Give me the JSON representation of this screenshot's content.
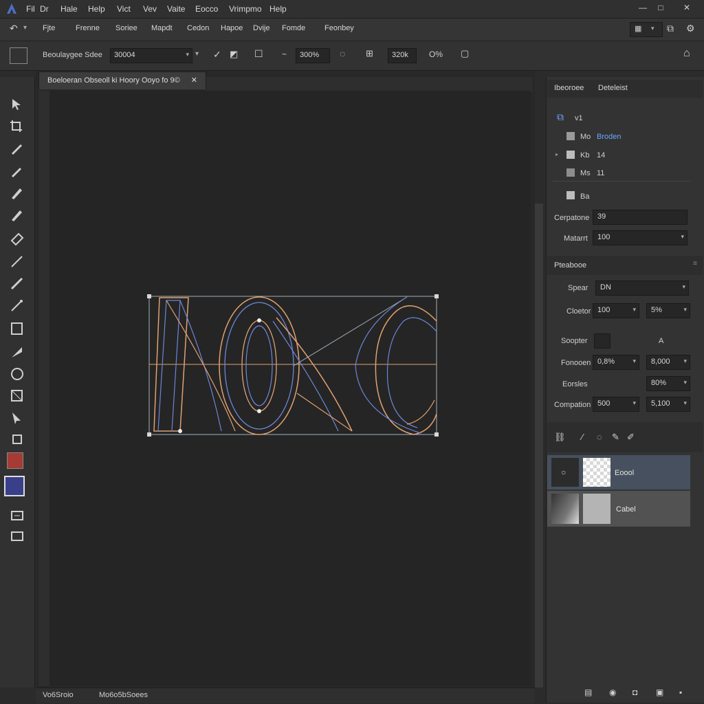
{
  "menubar": {
    "items": [
      "Fil",
      "Dr",
      "Hale",
      "Help",
      "Vict",
      "Vev",
      "Vaite",
      "Eocco",
      "Vrimpmo",
      "Help"
    ],
    "window_controls": [
      "—",
      "□",
      "✕"
    ]
  },
  "toolbar1": {
    "items": [
      "Fjte",
      "Frenne",
      "Soriee",
      "Mapdt",
      "Cedon",
      "Hapoe",
      "Dvije",
      "Fomde",
      "Feonbey"
    ]
  },
  "toolbar2": {
    "preset": "Beoulaygee Sdee",
    "size_value": "30004",
    "zoom_value": "300%",
    "field_value": "320k",
    "option": "O%"
  },
  "document": {
    "tab_title": "Boeloeran Obseoll ki Hoory Ooyo fo 9©",
    "tab_close": "✕",
    "status_left": "Vo6Sroio",
    "status_right": "Mo6o5bSoees"
  },
  "properties_panel": {
    "tabs": [
      "Ibeoroee",
      "Deteleist"
    ],
    "rows": [
      {
        "label": "v1",
        "value": ""
      },
      {
        "label": "Mo",
        "value": "Broden"
      },
      {
        "label": "Kb",
        "value": "14"
      },
      {
        "label": "Ms",
        "value": "11"
      },
      {
        "label": "Ba",
        "value": ""
      }
    ],
    "opacity_label": "Cerpatone",
    "opacity_value": "39",
    "material_label": "Matarrt",
    "material_value": "100"
  },
  "paragraph_panel": {
    "title": "Pteabooe",
    "rows": [
      {
        "label": "Spear",
        "value": "DN"
      },
      {
        "label": "Cloetor",
        "value": "100",
        "value2": "5%"
      },
      {
        "label": "Soopter",
        "value": "",
        "aux": "A"
      },
      {
        "label": "Fonooen",
        "value": "0,8%",
        "value2": "8,000"
      },
      {
        "label": "Eorsles",
        "value": "",
        "value2": "80%"
      },
      {
        "label": "Compation",
        "value": "500",
        "value2": "5,100"
      }
    ]
  },
  "layers_panel": {
    "layers": [
      {
        "name": "Eoool",
        "selected": true
      },
      {
        "name": "Cabel",
        "selected": false
      }
    ]
  },
  "colors": {
    "foreground": "#a63a35",
    "background_swatch": "#3a3f8a",
    "accent": "#6ea5ff"
  }
}
